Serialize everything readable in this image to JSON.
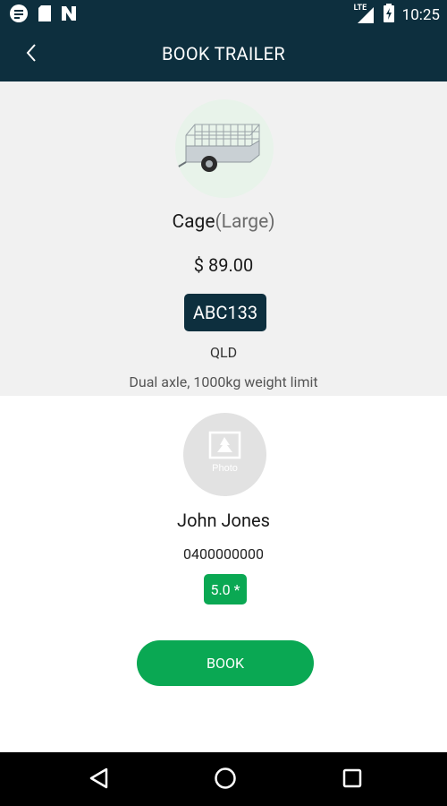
{
  "status_bar": {
    "time": "10:25",
    "network": "LTE",
    "left_icons": [
      "app-notification-icon",
      "sd-card-icon",
      "n-app-icon"
    ],
    "right_icons": [
      "signal-icon",
      "battery-charging-icon"
    ]
  },
  "app_bar": {
    "title": "BOOK TRAILER",
    "back_icon": "chevron-left-icon"
  },
  "trailer": {
    "name": "Cage",
    "size": "(Large)",
    "price": "$ 89.00",
    "plate": "ABC133",
    "state": "QLD",
    "description": "Dual axle, 1000kg weight limit"
  },
  "owner": {
    "photo_placeholder": "Photo",
    "name": "John Jones",
    "phone": "0400000000",
    "rating": "5.0 *"
  },
  "actions": {
    "book_label": "BOOK"
  },
  "colors": {
    "primary_dark": "#0d2f3e",
    "accent_green": "#0aa853",
    "section_bg": "#f1f1f1"
  }
}
